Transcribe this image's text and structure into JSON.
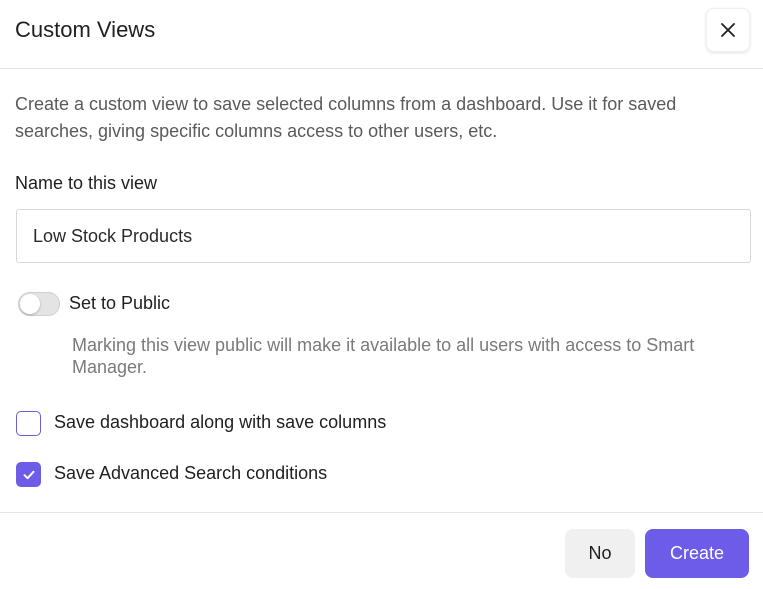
{
  "dialog": {
    "title": "Custom Views",
    "close_icon": "close-icon",
    "description": "Create a custom view to save selected columns from a dashboard. Use it for saved searches, giving specific columns access to other users, etc."
  },
  "name_field": {
    "label": "Name to this view",
    "value": "Low Stock Products"
  },
  "public_toggle": {
    "label": "Set to Public",
    "state": "off",
    "help": "Marking this view public will make it available to all users with access to Smart Manager."
  },
  "options": [
    {
      "label": "Save dashboard along with save columns",
      "checked": false
    },
    {
      "label": "Save Advanced Search conditions",
      "checked": true
    }
  ],
  "footer": {
    "no_label": "No",
    "create_label": "Create"
  },
  "colors": {
    "accent": "#6c5ce7",
    "secondary_button": "#f0f0f0"
  }
}
